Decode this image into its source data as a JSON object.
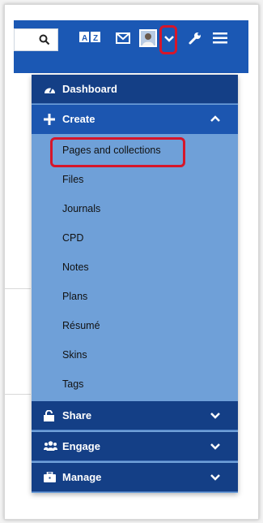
{
  "topbar": {
    "lang_label": "Â Z",
    "colors": {
      "bar": "#1b58b4",
      "highlight": "#d6162a",
      "menu_dark": "#143f86",
      "submenu": "#6fa0d8"
    }
  },
  "menu": {
    "dashboard": "Dashboard",
    "create": "Create",
    "create_items": [
      "Pages and collections",
      "Files",
      "Journals",
      "CPD",
      "Notes",
      "Plans",
      "Résumé",
      "Skins",
      "Tags"
    ],
    "share": "Share",
    "engage": "Engage",
    "manage": "Manage"
  },
  "icons": {
    "search": "search-icon",
    "language": "language-icon",
    "mail": "mail-icon",
    "avatar": "avatar",
    "dropdown": "chevron-down-icon",
    "admin": "wrench-icon",
    "menu": "hamburger-icon"
  }
}
